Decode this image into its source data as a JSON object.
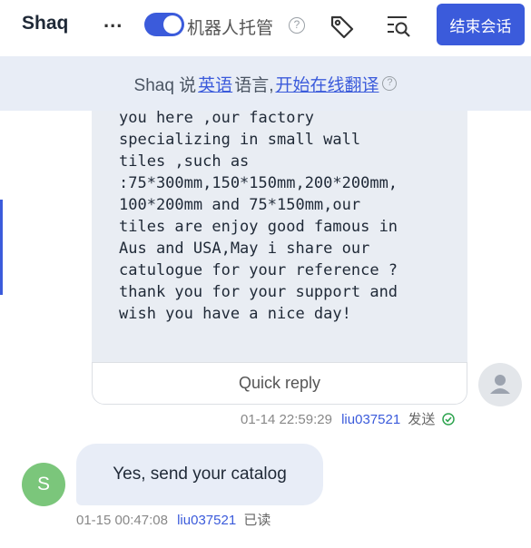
{
  "header": {
    "contact_name": "Shaq",
    "more_label": "...",
    "robot_toggle_label": "机器人托管",
    "robot_toggle_on": true,
    "help_glyph": "?",
    "end_button_label": "结束会话",
    "accent_color": "#3b5bdb",
    "icons": [
      "tag-icon",
      "search-list-icon"
    ]
  },
  "translate_bar": {
    "prefix": "Shaq 说",
    "language": "英语",
    "middle": "语言,",
    "action": "开始在线翻译",
    "help_glyph": "?"
  },
  "incoming": {
    "text": "you here ,our factory\nspecializing in small wall\ntiles ,such as\n:75*300mm,150*150mm,200*200mm,\n100*200mm and 75*150mm,our\ntiles are enjoy good famous in\nAus and USA,May i share our\ncatulogue for your reference ?\nthank you for your support and\nwish you have a nice day!",
    "quick_reply_label": "Quick reply",
    "timestamp": "01-14 22:59:29",
    "agent": "liu037521",
    "status": "发送"
  },
  "reply": {
    "avatar_letter": "S",
    "text": "Yes, send your catalog",
    "timestamp": "01-15 00:47:08",
    "agent": "liu037521",
    "status": "已读"
  }
}
